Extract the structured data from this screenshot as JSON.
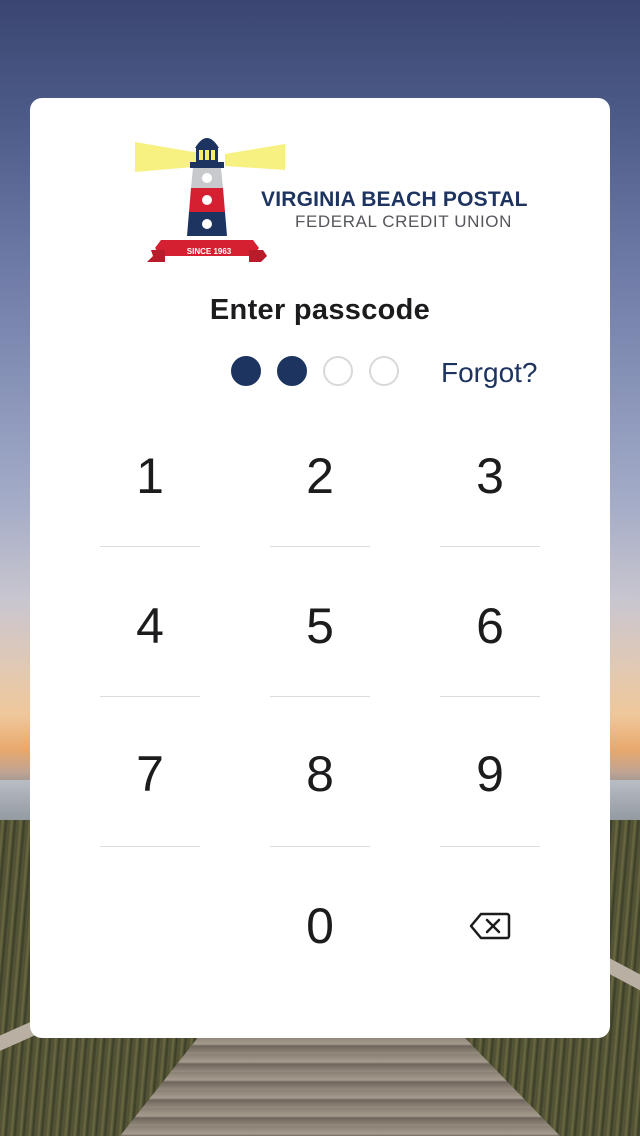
{
  "brand": {
    "name": "VIRGINIA BEACH POSTAL",
    "subtitle": "FEDERAL CREDIT UNION",
    "since": "SINCE 1963",
    "colors": {
      "navy": "#1d3461",
      "red": "#d42030",
      "beam": "#f5ee6a"
    }
  },
  "passcode": {
    "title": "Enter passcode",
    "length": 4,
    "entered": 2,
    "forgot_label": "Forgot?"
  },
  "keypad": {
    "keys": [
      "1",
      "2",
      "3",
      "4",
      "5",
      "6",
      "7",
      "8",
      "9",
      "0"
    ],
    "delete_icon": "backspace-icon"
  }
}
